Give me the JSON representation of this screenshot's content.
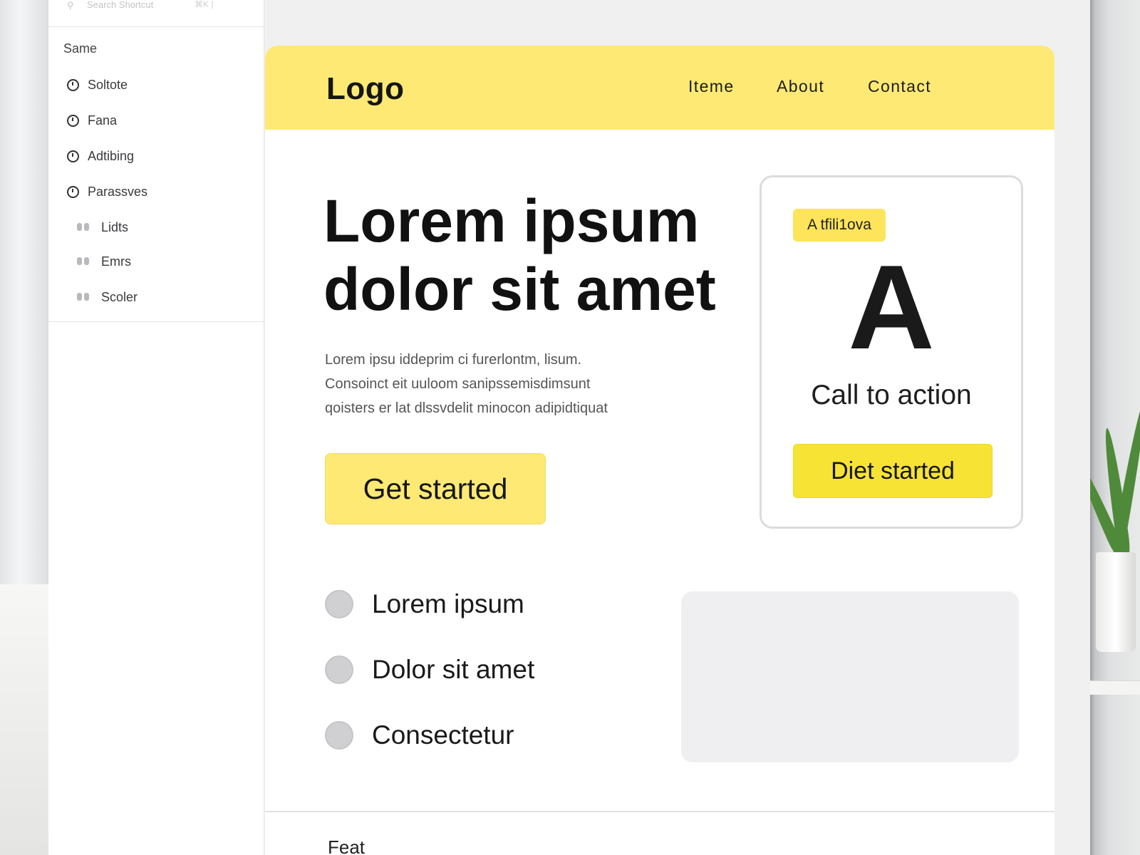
{
  "sidebar": {
    "search_placeholder": "Search Shortcut",
    "shortcut_hint": "⌘K  |",
    "section_title": "Same",
    "items": [
      {
        "label": "Soltote",
        "icon": "clock-icon"
      },
      {
        "label": "Fana",
        "icon": "clock-icon"
      },
      {
        "label": "Adtibing",
        "icon": "clock-icon"
      },
      {
        "label": "Parassves",
        "icon": "clock-icon"
      }
    ],
    "subitems": [
      {
        "label": "Lidts",
        "icon": "toggle-icon"
      },
      {
        "label": "Emrs",
        "icon": "toggle-icon"
      },
      {
        "label": "Scoler",
        "icon": "toggle-icon"
      }
    ]
  },
  "header": {
    "logo": "Logo",
    "nav": [
      "Iteme",
      "About",
      "Contact"
    ]
  },
  "hero": {
    "title_line1": "Lorem ipsum",
    "title_line2": "dolor sit amet",
    "body_line1": "Lorem ipsu iddeprim ci furerlontm, lisum.",
    "body_line2": "Consoinct eit uuloom sanipssemisdimsunt",
    "body_line3": "qoisters er lat dlssvdelit minocon adipidtiquat",
    "primary_button": "Get started"
  },
  "cta_card": {
    "badge": "A tfili1ova",
    "big_letter": "A",
    "label": "Call to action",
    "button": "Diet started"
  },
  "features": [
    "Lorem ipsum",
    "Dolor sit amet",
    "Consectetur"
  ],
  "footer": {
    "peek_text": "Feat"
  },
  "colors": {
    "accent": "#fde974",
    "accent_strong": "#f7e333",
    "badge": "#fde45a",
    "placeholder": "#efeff1"
  }
}
